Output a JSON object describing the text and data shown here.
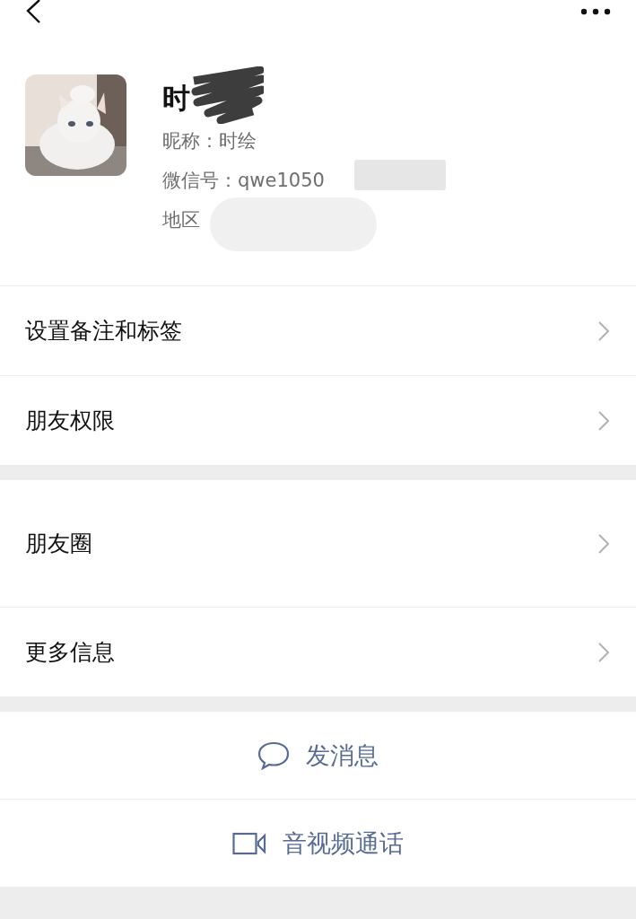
{
  "profile": {
    "name": "时",
    "nickname": "昵称：时绘",
    "wechat_id": "微信号：qwe1050",
    "region": "地区"
  },
  "sections": [
    {
      "rows": [
        "设置备注和标签",
        "朋友权限"
      ]
    },
    {
      "rows": [
        "朋友圈",
        "更多信息"
      ]
    }
  ],
  "actions": [
    "发消息",
    "音视频通话"
  ]
}
